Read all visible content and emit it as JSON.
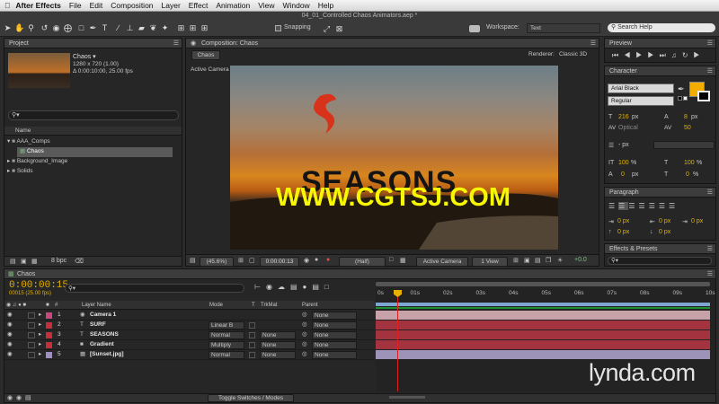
{
  "menubar": {
    "app": "After Effects",
    "items": [
      "File",
      "Edit",
      "Composition",
      "Layer",
      "Effect",
      "Animation",
      "View",
      "Window",
      "Help"
    ]
  },
  "toolbar": {
    "window_title": "04_01_Controlled Chaos Animators.aep *",
    "snapping": "Snapping",
    "workspace_label": "Workspace:",
    "workspace_value": "Text",
    "search_help": "Search Help"
  },
  "project": {
    "tab": "Project",
    "item_name": "Chaos ▾",
    "item_size": "1280 x 720 (1.00)",
    "item_duration": "Δ 0:00:10:00, 25.00 fps",
    "column_name": "Name",
    "bpc": "8 bpc",
    "tree": [
      {
        "label": "AAA_Comps",
        "type": "folder",
        "indent": 0
      },
      {
        "label": "Chaos",
        "type": "comp",
        "indent": 1,
        "selected": true
      },
      {
        "label": "Background_Image",
        "type": "folder",
        "indent": 0
      },
      {
        "label": "Solids",
        "type": "folder",
        "indent": 0
      }
    ]
  },
  "composition": {
    "tab": "Composition: Chaos",
    "subtab": "Chaos",
    "renderer_label": "Renderer:",
    "renderer_value": "Classic 3D",
    "view_label": "Active Camera",
    "zoom": "(45.6%)",
    "timecode": "0:00:00:13",
    "resolution": "(Half)",
    "camera": "Active Camera",
    "views": "1 View",
    "exposure": "+0.0",
    "scene_title": "SEASONS",
    "watermark": "WWW.CGTSJ.COM"
  },
  "preview": {
    "tab": "Preview"
  },
  "character": {
    "tab": "Character",
    "font": "Arial Black",
    "style": "Regular",
    "size": "216",
    "size_unit": "px",
    "leading": "8",
    "leading_unit": "px",
    "kerning": "Optical",
    "tracking": "50",
    "stroke_unit": "- px",
    "vscale": "100",
    "vscale_unit": "%",
    "hscale": "100",
    "hscale_unit": "%",
    "baseline": "0",
    "baseline_unit": "px",
    "tsume": "0",
    "tsume_unit": "%",
    "colors": {
      "fill": "#f2ad00",
      "stroke": "#000000"
    }
  },
  "paragraph": {
    "tab": "Paragraph",
    "indent_values": [
      "0 px",
      "0 px",
      "0 px",
      "0 px",
      "0 px"
    ]
  },
  "effects": {
    "tab": "Effects & Presets"
  },
  "timeline": {
    "tab": "Chaos",
    "timecode": "0:00:00:15",
    "timecode_sub": "00015 (25.00 fps)",
    "columns": {
      "layer_name": "Layer Name",
      "mode": "Mode",
      "t": "T",
      "trkmat": "TrkMat",
      "parent": "Parent"
    },
    "ruler": [
      "0s",
      "01s",
      "02s",
      "03s",
      "04s",
      "05s",
      "06s",
      "07s",
      "08s",
      "09s",
      "10s"
    ],
    "toggle": "Toggle Switches / Modes",
    "layers": [
      {
        "num": "1",
        "name": "Camera 1",
        "icon": "camera",
        "label_color": "#c7487a",
        "mode": "",
        "trkmat": "",
        "parent": "None",
        "bar": "#c7a2a8"
      },
      {
        "num": "2",
        "name": "SURF",
        "icon": "text",
        "label_color": "#c4303a",
        "mode": "Linear B",
        "trkmat": "",
        "parent": "None",
        "bar": "#a3333f"
      },
      {
        "num": "3",
        "name": "SEASONS",
        "icon": "text",
        "label_color": "#c4303a",
        "mode": "Normal",
        "trkmat": "None",
        "parent": "None",
        "bar": "#a3333f"
      },
      {
        "num": "4",
        "name": "Gradient",
        "icon": "solid",
        "label_color": "#c4303a",
        "mode": "Multiply",
        "trkmat": "None",
        "parent": "None",
        "bar": "#a3333f"
      },
      {
        "num": "5",
        "name": "[Sunset.jpg]",
        "icon": "footage",
        "label_color": "#9e8fc4",
        "mode": "Normal",
        "trkmat": "None",
        "parent": "None",
        "bar": "#9d92b8"
      }
    ]
  },
  "brand": {
    "logo": "lynda.com"
  }
}
